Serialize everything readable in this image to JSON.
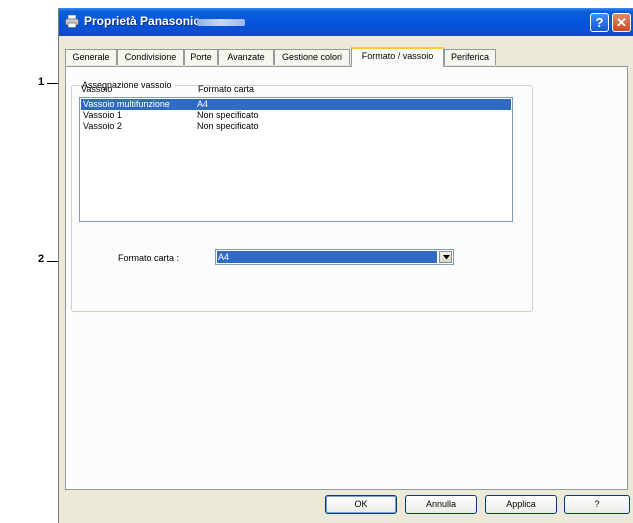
{
  "callouts": {
    "one": "1",
    "two": "2"
  },
  "window": {
    "title": "Proprietà Panasonic",
    "help_glyph": "?",
    "close_glyph": "✕"
  },
  "tabs": [
    {
      "label": "Generale"
    },
    {
      "label": "Condivisione"
    },
    {
      "label": "Porte"
    },
    {
      "label": "Avanzate"
    },
    {
      "label": "Gestione colori"
    },
    {
      "label": "Formato / vassoio",
      "active": true
    },
    {
      "label": "Periferica"
    }
  ],
  "tray_group": {
    "label": "Assegnazione vassoio",
    "col_tray": "Vassoio",
    "col_paper": "Formato carta",
    "rows": [
      {
        "tray": "Vassoio multifunzione",
        "paper": "A4",
        "selected": true
      },
      {
        "tray": "Vassoio 1",
        "paper": "Non specificato"
      },
      {
        "tray": "Vassoio 2",
        "paper": "Non specificato"
      }
    ],
    "paper_label": "Formato carta :",
    "paper_value": "A4"
  },
  "buttons": {
    "ok": "OK",
    "cancel": "Annulla",
    "apply": "Applica",
    "help": "?"
  },
  "colors": {
    "titlebar": "#0554e0",
    "selection": "#316ac5",
    "active_tab_accent": "#ffc83c"
  },
  "icons": {
    "title": "printer-icon",
    "dropdown": "chevron-down-icon"
  }
}
